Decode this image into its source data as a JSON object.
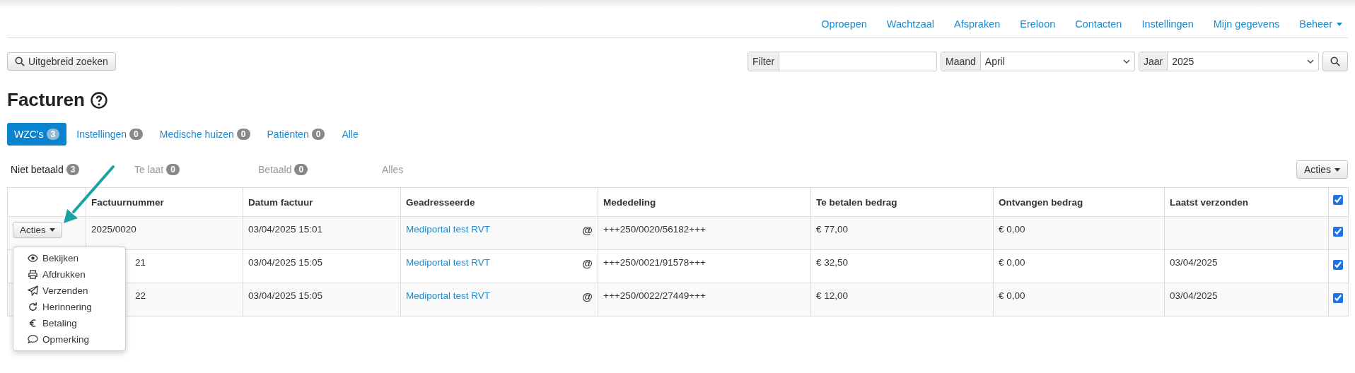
{
  "nav": [
    {
      "label": "Oproepen",
      "dropdown": false
    },
    {
      "label": "Wachtzaal",
      "dropdown": false
    },
    {
      "label": "Afspraken",
      "dropdown": false
    },
    {
      "label": "Ereloon",
      "dropdown": false
    },
    {
      "label": "Contacten",
      "dropdown": false
    },
    {
      "label": "Instellingen",
      "dropdown": false
    },
    {
      "label": "Mijn gegevens",
      "dropdown": false
    },
    {
      "label": "Beheer",
      "dropdown": true
    }
  ],
  "search_button": "Uitgebreid zoeken",
  "filters": [
    {
      "kind": "text",
      "label": "Filter"
    },
    {
      "kind": "select",
      "label": "Maand",
      "value": "April"
    },
    {
      "kind": "select",
      "label": "Jaar",
      "value": "2025"
    }
  ],
  "title": "Facturen",
  "tabs": [
    {
      "label": "WZC's",
      "count": "3",
      "selected": true
    },
    {
      "label": "Instellingen",
      "count": "0",
      "selected": false
    },
    {
      "label": "Medische huizen",
      "count": "0",
      "selected": false
    },
    {
      "label": "Patiënten",
      "count": "0",
      "selected": false
    },
    {
      "label": "Alle",
      "selected": false
    }
  ],
  "subtabs": [
    {
      "label": "Niet betaald",
      "count": "3",
      "selected": true
    },
    {
      "label": "Te laat",
      "count": "0",
      "selected": false
    },
    {
      "label": "Betaald",
      "count": "0",
      "selected": false
    },
    {
      "label": "Alles",
      "selected": false
    }
  ],
  "actions_button": "Acties",
  "table": {
    "columns": [
      "Factuurnummer",
      "Datum factuur",
      "Geadresseerde",
      "Mededeling",
      "Te betalen bedrag",
      "Ontvangen bedrag",
      "Laatst verzonden"
    ],
    "all_checked": true,
    "rows": [
      {
        "actions": "Acties",
        "number": "2025/0020",
        "covered": false,
        "date": "03/04/2025 15:01",
        "addressee": "Mediportal test RVT",
        "mail": "@",
        "reference": "+++250/0020/56182+++",
        "amount": "€ 77,00",
        "received": "€ 0,00",
        "checked": true
      },
      {
        "number": "21",
        "covered": true,
        "date": "03/04/2025 15:05",
        "addressee": "Mediportal test RVT",
        "mail": "@",
        "reference": "+++250/0021/91578+++",
        "amount": "€ 32,50",
        "received": "€ 0,00",
        "last_sent": "03/04/2025",
        "checked": true
      },
      {
        "number": "22",
        "covered": true,
        "date": "03/04/2025 15:05",
        "addressee": "Mediportal test RVT",
        "mail": "@",
        "reference": "+++250/0022/27449+++",
        "amount": "€ 12,00",
        "received": "€ 0,00",
        "last_sent": "03/04/2025",
        "checked": true
      }
    ]
  },
  "menu": [
    {
      "kind": "eye",
      "label": "Bekijken"
    },
    {
      "kind": "print",
      "label": "Afdrukken"
    },
    {
      "kind": "send",
      "label": "Verzenden"
    },
    {
      "kind": "redo",
      "label": "Herinnering"
    },
    {
      "kind": "euro",
      "label": "Betaling"
    },
    {
      "kind": "comment",
      "label": "Opmerking"
    }
  ]
}
